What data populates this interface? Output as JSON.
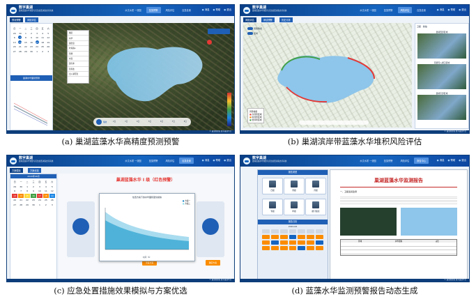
{
  "figure": {
    "captions": {
      "a": "(a) 巢湖蓝藻水华高精度预测预警",
      "b": "(b) 巢湖滨岸带蓝藻水华堆积风险评估",
      "c": "(c) 应急处置措施效果模拟与方案优选",
      "d": "(d) 蓝藻水华监测预警报告动态生成"
    }
  },
  "app": {
    "title": "数字巢湖",
    "subtitle": "巢湖蓝藻水华预警与应急处置决策支持系统",
    "nav": [
      "水文水质 一张图",
      "蓝藻预警",
      "风险评估",
      "应急处置",
      "报告中心"
    ],
    "utils": [
      "消息",
      "帮助",
      "退出"
    ],
    "footer": "© 巢湖管理局 数字巢湖平台"
  },
  "panel_a": {
    "tabs": [
      "预测预警",
      "风险评估"
    ],
    "calendar": {
      "weekdays": [
        "日",
        "一",
        "二",
        "三",
        "四",
        "五",
        "六"
      ],
      "days": [
        "29",
        "30",
        "1",
        "2",
        "3",
        "4",
        "5",
        "6",
        "7",
        "8",
        "9",
        "10",
        "11",
        "12",
        "13",
        "14",
        "15",
        "16",
        "17",
        "18",
        "19",
        "20",
        "21",
        "22",
        "23",
        "24",
        "25",
        "26",
        "27",
        "28",
        "29",
        "30",
        "1",
        "2",
        "3"
      ]
    },
    "layer_menu": [
      "图层",
      "水华",
      "藻密度",
      "叶绿素a",
      "风场",
      "水温",
      "透光率",
      "营养盐",
      "出入湖河流"
    ],
    "chart_title": "巢湖水华面积预测",
    "timeline": [
      "2日",
      "3日",
      "4日",
      "5日",
      "6日",
      "7日",
      "8日"
    ],
    "play_label": "播放"
  },
  "panel_b": {
    "tabs": [
      "风险评估",
      "岸线预警",
      "历史分析"
    ],
    "toggles": [
      "风险等级",
      "实时"
    ],
    "legend_title": "风险等级",
    "legend": [
      "高风险区域",
      "中风险区域",
      "低风险区域"
    ],
    "legend_colors": [
      "#e53935",
      "#fb8c00",
      "#43a047"
    ],
    "side_tabs": [
      "卫星",
      "航拍"
    ],
    "thumbs": [
      "巢湖西部区域",
      "南淝河入湖口区域",
      "巢湖东部区域"
    ]
  },
  "panel_c": {
    "tabs": [
      "方案模拟",
      "方案优选"
    ],
    "warning_title": "巢湖蓝藻水华 I 级（红色预警）",
    "sim_title": "处置方案下的水华面积变化模拟",
    "legend": [
      "方案一",
      "方案二"
    ],
    "x_label": "时间（h）",
    "select_btns": [
      "查看方案",
      "确定方案"
    ],
    "calendar_header": "2020年06月"
  },
  "panel_d": {
    "side_title": "报告类型",
    "report_types": [
      "日报",
      "周报",
      "月报",
      "专报",
      "年报",
      "统计报表"
    ],
    "date_title": "报告日历",
    "month": "2020-06",
    "report_title": "巢湖蓝藻水华监测报告",
    "report_section": "一、卫星遥感监测",
    "table_header": [
      "区域",
      "水华面积",
      "占比"
    ]
  }
}
